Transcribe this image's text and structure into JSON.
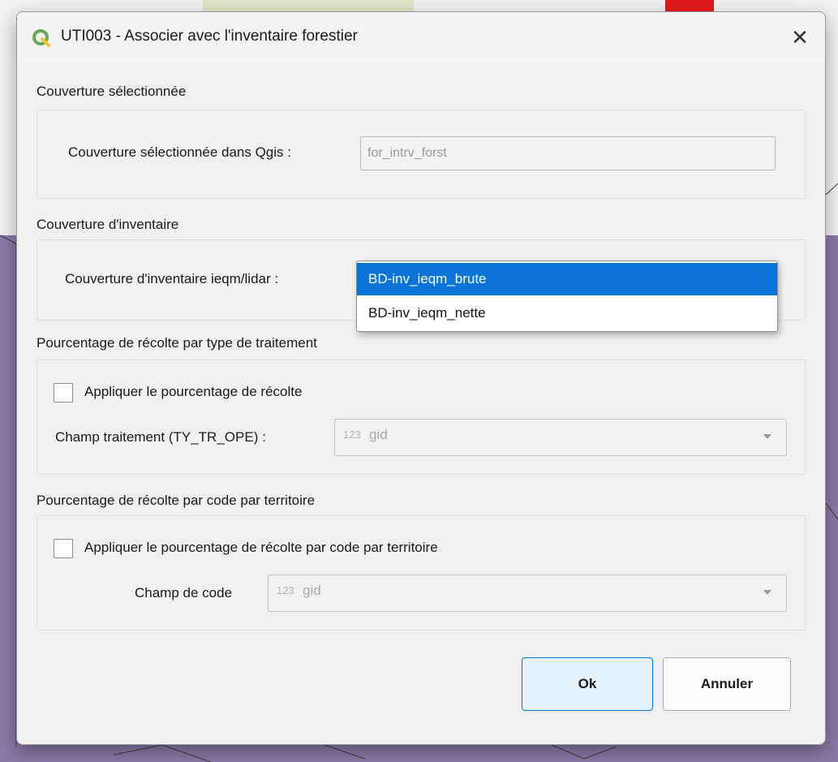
{
  "window": {
    "title": "UTI003 - Associer avec l'inventaire forestier",
    "close_glyph": "✕"
  },
  "sections": {
    "selected_layer": {
      "title": "Couverture sélectionnée",
      "label": "Couverture sélectionnée dans Qgis :",
      "value": "for_intrv_forst"
    },
    "inventory_layer": {
      "title": "Couverture d'inventaire",
      "label": "Couverture d'inventaire ieqm/lidar :",
      "options": [
        "BD-inv_ieqm_brute",
        "BD-inv_ieqm_nette"
      ],
      "selected_index": 0
    },
    "harvest_by_treatment": {
      "title": "Pourcentage de récolte par type de traitement",
      "checkbox_label": "Appliquer le pourcentage de récolte",
      "checked": false,
      "field_label": "Champ traitement (TY_TR_OPE) :",
      "field_type": "123",
      "field_value": "gid"
    },
    "harvest_by_territory": {
      "title": "Pourcentage de récolte par code par territoire",
      "checkbox_label": "Appliquer le pourcentage de récolte par code par territoire",
      "checked": false,
      "field_label": "Champ de code",
      "field_type": "123",
      "field_value": "gid"
    }
  },
  "buttons": {
    "ok": "Ok",
    "cancel": "Annuler"
  },
  "colors": {
    "accent": "#0a74d8",
    "ok_border": "#0078d7",
    "qgis_green": "#6aa84f",
    "qgis_yellow": "#f3c431"
  }
}
